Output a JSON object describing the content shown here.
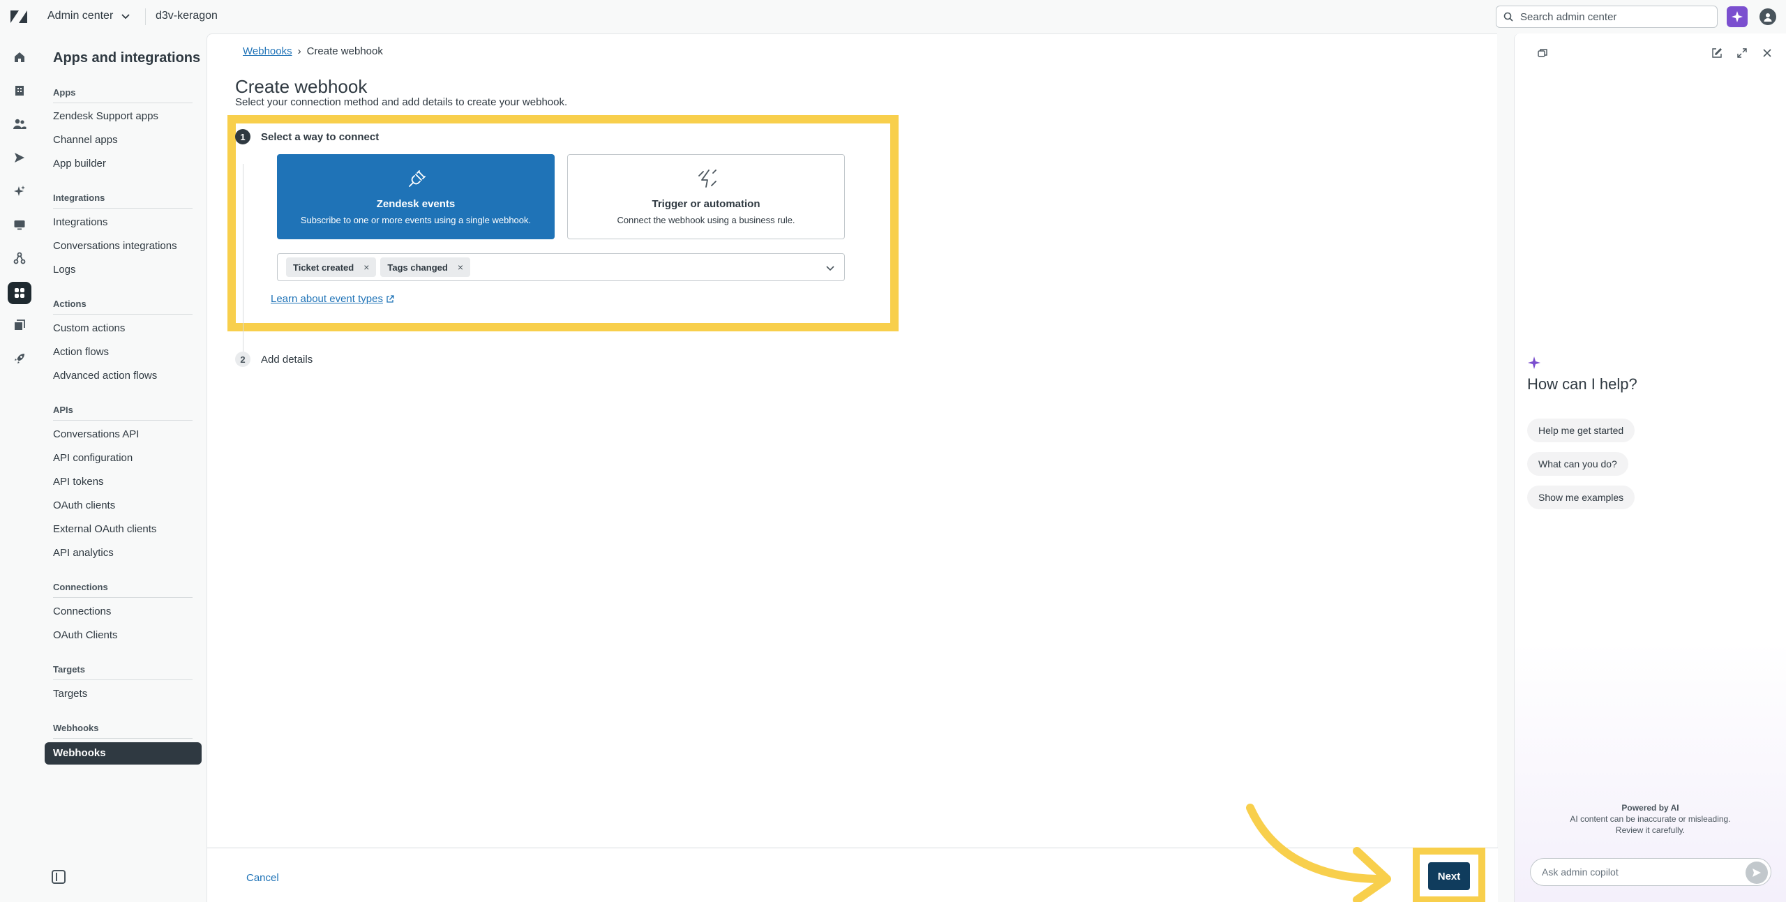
{
  "topbar": {
    "product": "Admin center",
    "account": "d3v-keragon",
    "search_placeholder": "Search admin center"
  },
  "nav": {
    "title": "Apps and integrations",
    "sections": [
      {
        "label": "Apps",
        "items": [
          "Zendesk Support apps",
          "Channel apps",
          "App builder"
        ]
      },
      {
        "label": "Integrations",
        "items": [
          "Integrations",
          "Conversations integrations",
          "Logs"
        ]
      },
      {
        "label": "Actions",
        "items": [
          "Custom actions",
          "Action flows",
          "Advanced action flows"
        ]
      },
      {
        "label": "APIs",
        "items": [
          "Conversations API",
          "API configuration",
          "API tokens",
          "OAuth clients",
          "External OAuth clients",
          "API analytics"
        ]
      },
      {
        "label": "Connections",
        "items": [
          "Connections",
          "OAuth Clients"
        ]
      },
      {
        "label": "Targets",
        "items": [
          "Targets"
        ]
      },
      {
        "label": "Webhooks",
        "items": [
          "Webhooks"
        ]
      }
    ],
    "active_item": "Webhooks"
  },
  "main": {
    "breadcrumb": {
      "parent": "Webhooks",
      "separator": "›",
      "current": "Create webhook"
    },
    "title": "Create webhook",
    "subtitle": "Select your connection method and add details to create your webhook.",
    "step1": {
      "number": "1",
      "label": "Select a way to connect"
    },
    "step2": {
      "number": "2",
      "label": "Add details"
    },
    "cards": {
      "zendesk": {
        "title": "Zendesk events",
        "desc": "Subscribe to one or more events using a single webhook."
      },
      "trigger": {
        "title": "Trigger or automation",
        "desc": "Connect the webhook using a business rule."
      }
    },
    "tags": [
      "Ticket created",
      "Tags changed"
    ],
    "tag_remove": "×",
    "learn_link": "Learn about event types"
  },
  "footer": {
    "cancel": "Cancel",
    "next": "Next"
  },
  "copilot": {
    "heading": "How can I help?",
    "chips": [
      "Help me get started",
      "What can you do?",
      "Show me examples"
    ],
    "powered_title": "Powered by AI",
    "powered_line1": "AI content can be inaccurate or misleading.",
    "powered_line2": "Review it carefully.",
    "ask_placeholder": "Ask admin copilot"
  },
  "colors": {
    "accent": "#1f73b7",
    "highlight": "#f8cf4c",
    "ai": "#7b4fcf",
    "dark": "#2f3941",
    "primary_button": "#103c5d"
  }
}
